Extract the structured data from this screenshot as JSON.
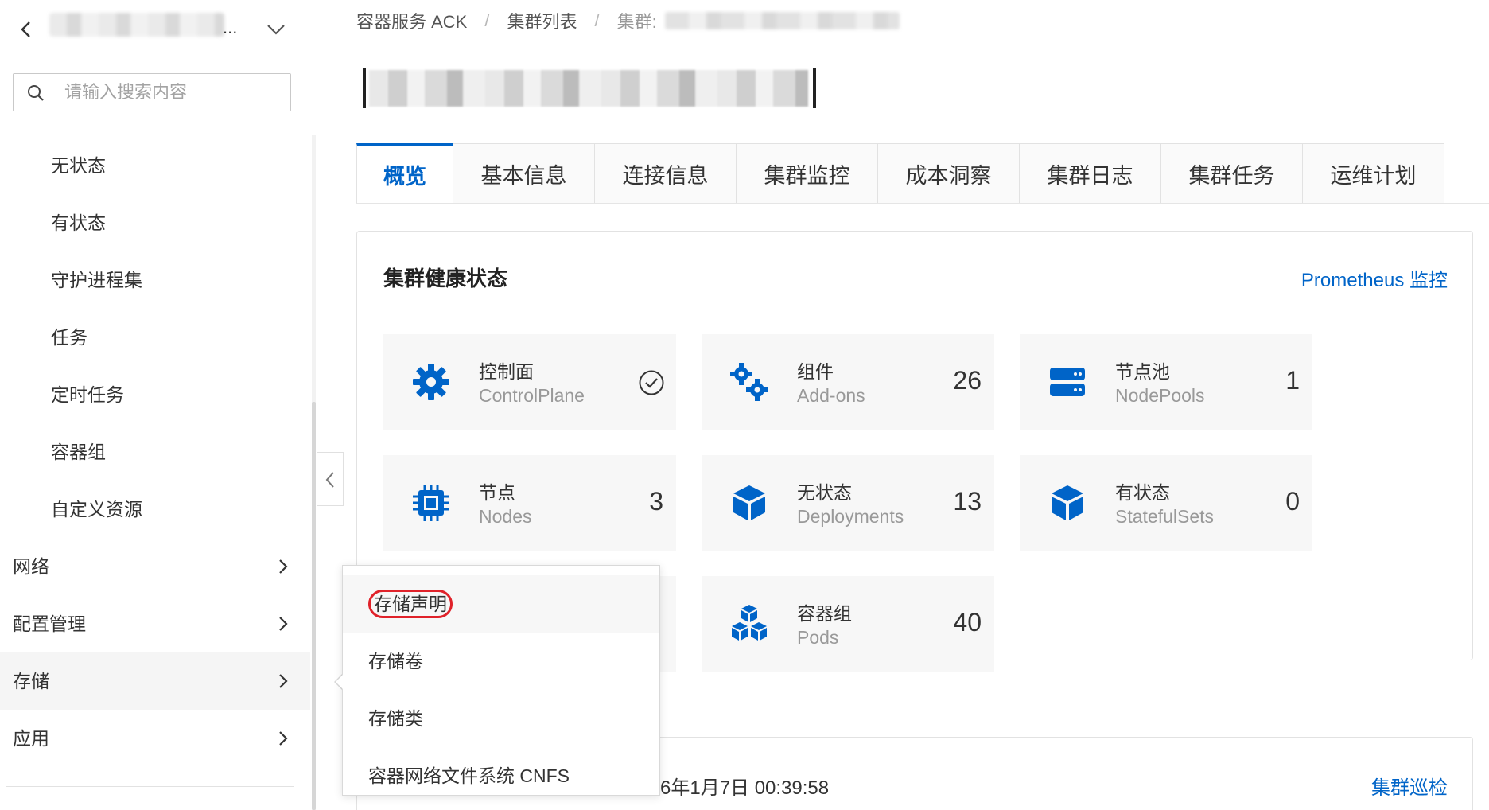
{
  "sidebar": {
    "ellipsis": "...",
    "search_placeholder": "请输入搜索内容",
    "sub_items": [
      "无状态",
      "有状态",
      "守护进程集",
      "任务",
      "定时任务",
      "容器组",
      "自定义资源"
    ],
    "groups": [
      "网络",
      "配置管理",
      "存储",
      "应用"
    ],
    "active_group": "存储"
  },
  "breadcrumb": {
    "items": [
      "容器服务 ACK",
      "集群列表"
    ],
    "current_prefix": "集群:"
  },
  "tabs": [
    "概览",
    "基本信息",
    "连接信息",
    "集群监控",
    "成本洞察",
    "集群日志",
    "集群任务",
    "运维计划"
  ],
  "active_tab": "概览",
  "health": {
    "title": "集群健康状态",
    "link": "Prometheus 监控",
    "tiles": [
      {
        "name": "控制面",
        "sub": "ControlPlane",
        "icon": "gear-icon",
        "status": "check-circle-icon"
      },
      {
        "name": "组件",
        "sub": "Add-ons",
        "value": "26",
        "icon": "gears-icon"
      },
      {
        "name": "节点池",
        "sub": "NodePools",
        "value": "1",
        "icon": "server-icon"
      },
      {
        "name": "节点",
        "sub": "Nodes",
        "value": "3",
        "icon": "chip-icon"
      },
      {
        "name": "无状态",
        "sub": "Deployments",
        "value": "13",
        "icon": "cube-icon"
      },
      {
        "name": "有状态",
        "sub": "StatefulSets",
        "value": "0",
        "icon": "cube-icon"
      },
      {
        "name": "容器组",
        "sub": "Pods",
        "value": "40",
        "icon": "cubes-icon"
      }
    ]
  },
  "inspection": {
    "time_partial": "6年1月7日 00:39:58",
    "link": "集群巡检"
  },
  "popup_menu": {
    "items": [
      "存储声明",
      "存储卷",
      "存储类",
      "容器网络文件系统 CNFS"
    ],
    "highlighted": "存储声明"
  },
  "colors": {
    "accent": "#0064c8",
    "highlight_ring": "#e0222a",
    "tile_bg": "#f7f7f7"
  }
}
